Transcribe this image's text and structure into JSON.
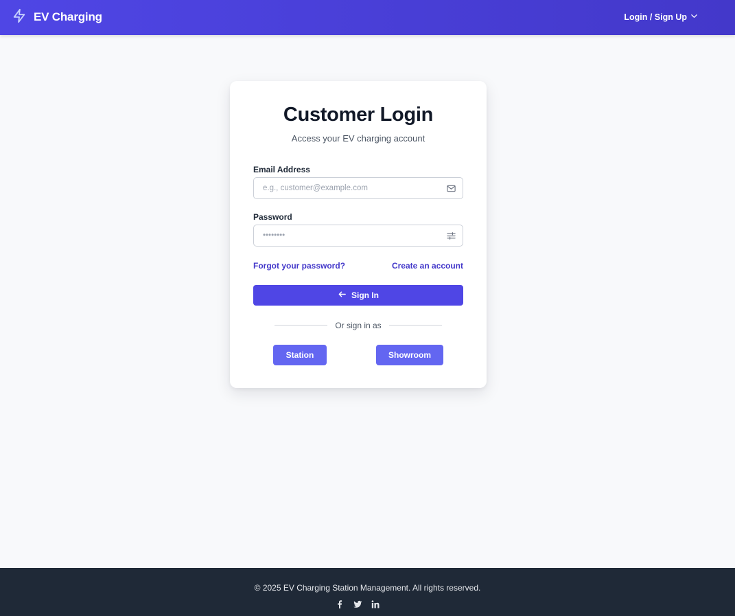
{
  "header": {
    "brand": "EV Charging",
    "brand_icon": "lightning-bolt-icon",
    "menu_label": "Login / Sign Up",
    "menu_icon": "chevron-down-icon",
    "background_color": "#4f46e5"
  },
  "login": {
    "title": "Customer Login",
    "subtitle": "Access your EV charging account",
    "email": {
      "label": "Email Address",
      "placeholder": "e.g., customer@example.com",
      "value": "",
      "icon": "mail-icon"
    },
    "password": {
      "label": "Password",
      "placeholder": "••••••••",
      "value": "",
      "icon": "sliders-icon"
    },
    "forgot_link": "Forgot your password?",
    "create_link": "Create an account",
    "signin_button": "Sign In",
    "signin_icon": "arrow-left-icon",
    "divider_text": "Or sign in as",
    "role_buttons": [
      "Station",
      "Showroom"
    ],
    "accent_color": "#4f46e5",
    "role_button_color": "#6366f1"
  },
  "footer": {
    "copyright": "© 2025 EV Charging Station Management. All rights reserved.",
    "socials": [
      "facebook-icon",
      "twitter-icon",
      "linkedin-icon"
    ],
    "background_color": "#1f2937"
  }
}
